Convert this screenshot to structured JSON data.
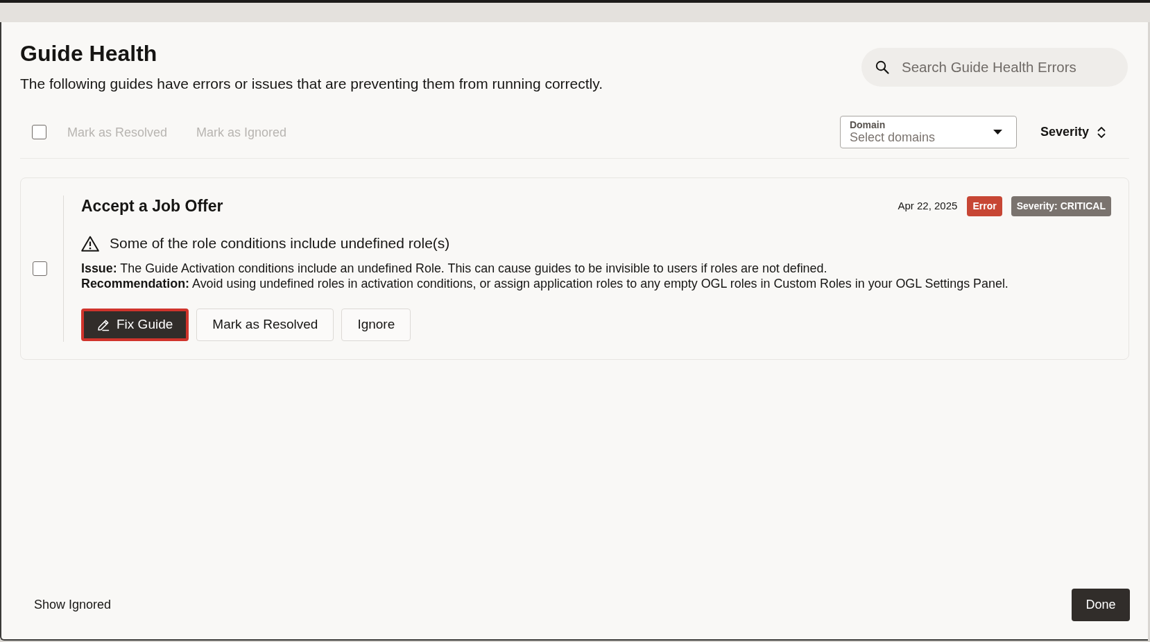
{
  "dialog": {
    "title": "Guide Health",
    "description": "The following guides have errors or issues that are preventing them from running correctly.",
    "search": {
      "placeholder": "Search Guide Health Errors"
    },
    "toolbar": {
      "select_all": {
        "checked": false
      },
      "actions": [
        {
          "label": "Mark as Resolved",
          "disabled": true
        },
        {
          "label": "Mark as Ignored",
          "disabled": true
        }
      ],
      "domain_filter": {
        "label": "Domain",
        "placeholder": "Select domains"
      },
      "sort": {
        "label": "Severity"
      }
    },
    "issues": [
      {
        "checked": false,
        "guide": "Accept a Job Offer",
        "date": "Apr 22, 2025",
        "badges": [
          {
            "label": "Error",
            "color": "#c74634"
          },
          {
            "label": "Severity: CRITICAL",
            "color": "#7a736e"
          }
        ],
        "summary": "Some of the role conditions include undefined role(s)",
        "details": [
          "**Issue:** The Guide Activation conditions include an undefined Role. This can cause guides to be invisible to users if roles are not defined.",
          "**Recommendation:** Avoid using undefined roles in activation conditions, or assign application roles to any empty OGL roles in Custom Roles in your OGL Settings Panel."
        ],
        "buttons": [
          {
            "label": "Fix Guide",
            "kind": "primary",
            "highlighted": true
          },
          {
            "label": "Mark as Resolved",
            "kind": "secondary",
            "highlighted": false
          },
          {
            "label": "Ignore",
            "kind": "secondary",
            "highlighted": false
          }
        ]
      }
    ],
    "footer": {
      "show_ignored": "Show Ignored",
      "done": "Done"
    }
  }
}
